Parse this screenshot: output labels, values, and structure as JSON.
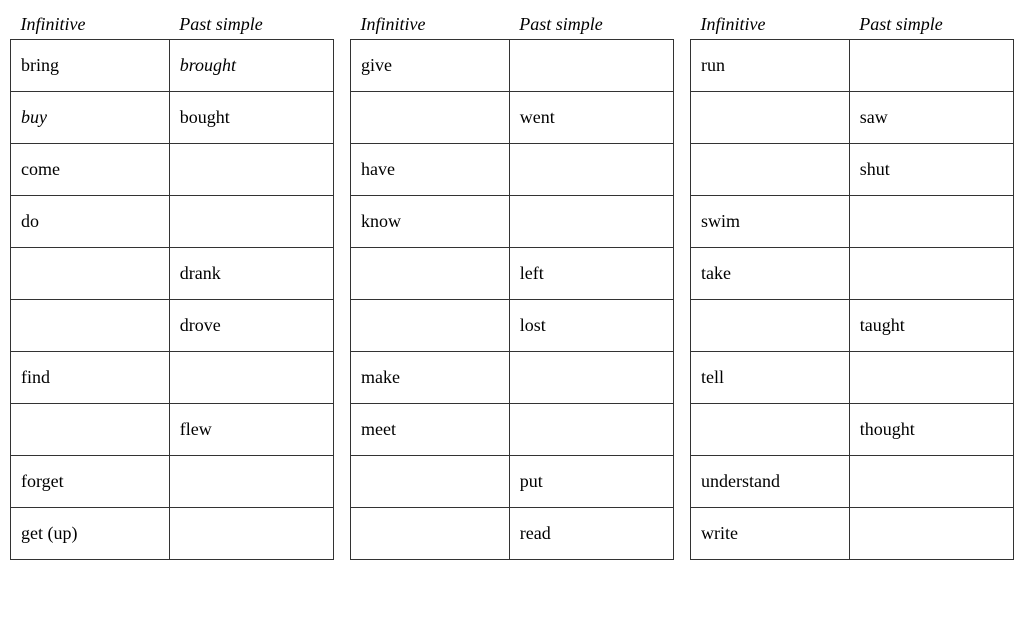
{
  "tables": [
    {
      "id": "table1",
      "headers": [
        "Infinitive",
        "Past simple"
      ],
      "rows": [
        {
          "infinitive": "bring",
          "past": "brought",
          "past_italic": true
        },
        {
          "infinitive": "buy",
          "past": "bought",
          "infinitive_italic": true,
          "past_italic": false
        },
        {
          "infinitive": "come",
          "past": ""
        },
        {
          "infinitive": "do",
          "past": ""
        },
        {
          "infinitive": "",
          "past": "drank",
          "past_italic": false
        },
        {
          "infinitive": "",
          "past": "drove",
          "past_italic": false
        },
        {
          "infinitive": "find",
          "past": ""
        },
        {
          "infinitive": "",
          "past": "flew",
          "past_italic": false
        },
        {
          "infinitive": "forget",
          "past": ""
        },
        {
          "infinitive": "get (up)",
          "past": ""
        }
      ]
    },
    {
      "id": "table2",
      "headers": [
        "Infinitive",
        "Past simple"
      ],
      "rows": [
        {
          "infinitive": "give",
          "past": ""
        },
        {
          "infinitive": "",
          "past": "went",
          "past_italic": false
        },
        {
          "infinitive": "have",
          "past": ""
        },
        {
          "infinitive": "know",
          "past": ""
        },
        {
          "infinitive": "",
          "past": "left",
          "past_italic": false
        },
        {
          "infinitive": "",
          "past": "lost",
          "past_italic": false
        },
        {
          "infinitive": "make",
          "past": ""
        },
        {
          "infinitive": "meet",
          "past": ""
        },
        {
          "infinitive": "",
          "past": "put",
          "past_italic": false
        },
        {
          "infinitive": "",
          "past": "read",
          "past_italic": false
        }
      ]
    },
    {
      "id": "table3",
      "headers": [
        "Infinitive",
        "Past simple"
      ],
      "rows": [
        {
          "infinitive": "run",
          "past": ""
        },
        {
          "infinitive": "",
          "past": "saw",
          "past_italic": false
        },
        {
          "infinitive": "",
          "past": "shut",
          "past_italic": false
        },
        {
          "infinitive": "swim",
          "past": ""
        },
        {
          "infinitive": "take",
          "past": ""
        },
        {
          "infinitive": "",
          "past": "taught",
          "past_italic": false
        },
        {
          "infinitive": "tell",
          "past": ""
        },
        {
          "infinitive": "",
          "past": "thought",
          "past_italic": false
        },
        {
          "infinitive": "understand",
          "past": ""
        },
        {
          "infinitive": "write",
          "past": ""
        }
      ]
    }
  ]
}
